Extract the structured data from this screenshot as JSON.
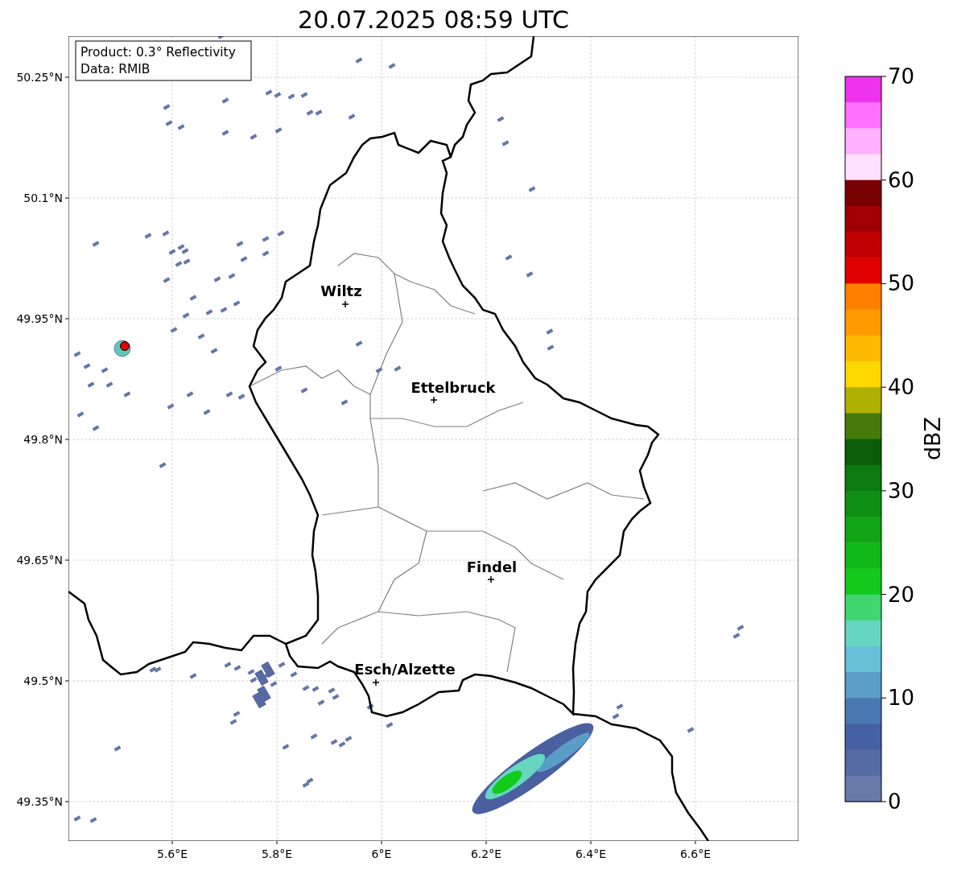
{
  "title": "20.07.2025 08:59 UTC",
  "info_box": [
    "Product: 0.3° Reflectivity",
    "Data: RMIB"
  ],
  "map": {
    "y_ticks": [
      "50.25°N",
      "50.1°N",
      "49.95°N",
      "49.8°N",
      "49.65°N",
      "49.5°N",
      "49.35°N"
    ],
    "x_ticks": [
      "5.6°E",
      "5.8°E",
      "6°E",
      "6.2°E",
      "6.4°E",
      "6.6°E"
    ],
    "cities": [
      {
        "name": "Wiltz"
      },
      {
        "name": "Ettelbruck"
      },
      {
        "name": "Findel"
      },
      {
        "name": "Esch/Alzette"
      }
    ]
  },
  "colorbar": {
    "label": "dBZ",
    "ticks": [
      "70",
      "60",
      "50",
      "40",
      "30",
      "20",
      "10",
      "0"
    ],
    "bins": [
      {
        "color": "#ee33ee"
      },
      {
        "color": "#ff70ff"
      },
      {
        "color": "#ffb0ff"
      },
      {
        "color": "#ffe0ff"
      },
      {
        "color": "#780000"
      },
      {
        "color": "#a00000"
      },
      {
        "color": "#c00000"
      },
      {
        "color": "#e00000"
      },
      {
        "color": "#ff7f00"
      },
      {
        "color": "#ff9a00"
      },
      {
        "color": "#ffb900"
      },
      {
        "color": "#ffd700"
      },
      {
        "color": "#b0b000"
      },
      {
        "color": "#467a0a"
      },
      {
        "color": "#0a5e0a"
      },
      {
        "color": "#0b7a10"
      },
      {
        "color": "#0e8f13"
      },
      {
        "color": "#12a513"
      },
      {
        "color": "#10b815"
      },
      {
        "color": "#13c919"
      },
      {
        "color": "#40d670"
      },
      {
        "color": "#66d6c0"
      },
      {
        "color": "#65c1d8"
      },
      {
        "color": "#5a9ec8"
      },
      {
        "color": "#4a78b0"
      },
      {
        "color": "#4560a3"
      },
      {
        "color": "#566aa3"
      },
      {
        "color": "#6a7aa8"
      }
    ]
  }
}
